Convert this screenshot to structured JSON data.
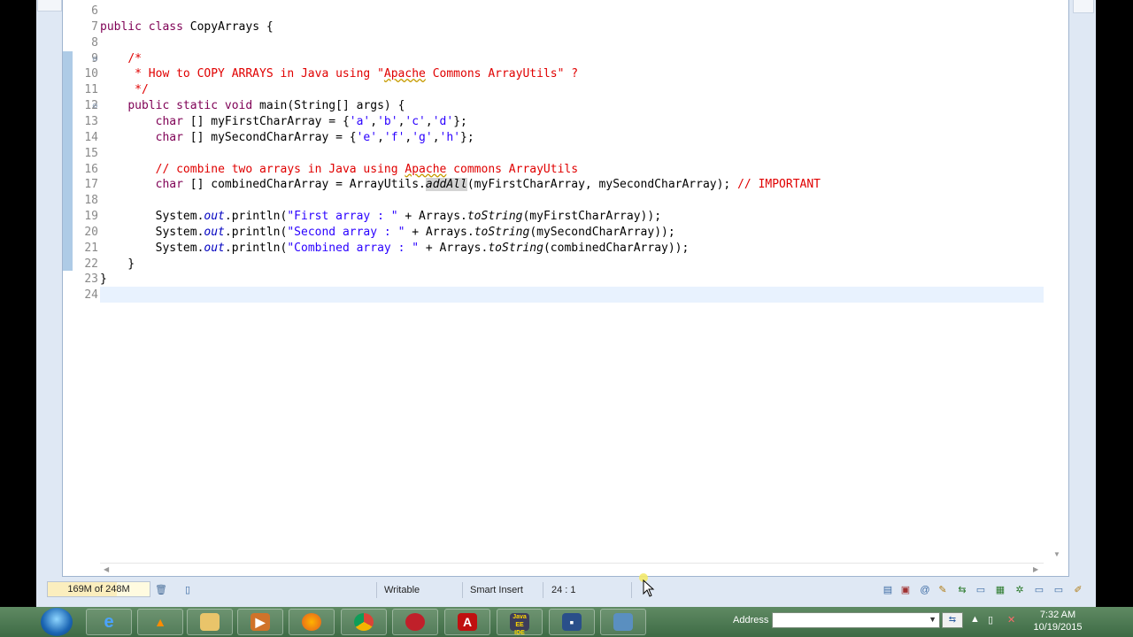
{
  "editor": {
    "lines": [
      {
        "no": "6",
        "html": ""
      },
      {
        "no": "7",
        "html": "<span class=\"kw\">public</span> <span class=\"kw\">class</span> CopyArrays {"
      },
      {
        "no": "8",
        "html": ""
      },
      {
        "no": "9",
        "html": "    <span class=\"cmt\">/*</span>"
      },
      {
        "no": "10",
        "html": "<span class=\"cmt\">     * How to COPY ARRAYS in Java using \"<span class=\"squig\">Apache</span> Commons ArrayUtils\" ?</span>"
      },
      {
        "no": "11",
        "html": "<span class=\"cmt\">     */</span>"
      },
      {
        "no": "12",
        "html": "    <span class=\"kw\">public</span> <span class=\"kw\">static</span> <span class=\"kw\">void</span> main(String[] args) {"
      },
      {
        "no": "13",
        "html": "        <span class=\"kw\">char</span> [] myFirstCharArray = {<span class=\"str\">'a'</span>,<span class=\"str\">'b'</span>,<span class=\"str\">'c'</span>,<span class=\"str\">'d'</span>};"
      },
      {
        "no": "14",
        "html": "        <span class=\"kw\">char</span> [] mySecondCharArray = {<span class=\"str\">'e'</span>,<span class=\"str\">'f'</span>,<span class=\"str\">'g'</span>,<span class=\"str\">'h'</span>};"
      },
      {
        "no": "15",
        "html": ""
      },
      {
        "no": "16",
        "html": "        <span class=\"cmt\">// combine two arrays in Java using <span class=\"squig\">Apache</span> commons ArrayUtils</span>"
      },
      {
        "no": "17",
        "html": "        <span class=\"kw\">char</span> [] combinedCharArray = ArrayUtils.<span class=\"ital hl\">addAll</span>(myFirstCharArray, mySecondCharArray); <span class=\"cmt\">// IMPORTANT</span>"
      },
      {
        "no": "18",
        "html": ""
      },
      {
        "no": "19",
        "html": "        System.<span class=\"fld\">out</span>.println(<span class=\"str\">\"First array : \"</span> + Arrays.<span class=\"ital\">toString</span>(myFirstCharArray));"
      },
      {
        "no": "20",
        "html": "        System.<span class=\"fld\">out</span>.println(<span class=\"str\">\"Second array : \"</span> + Arrays.<span class=\"ital\">toString</span>(mySecondCharArray));"
      },
      {
        "no": "21",
        "html": "        System.<span class=\"fld\">out</span>.println(<span class=\"str\">\"Combined array : \"</span> + Arrays.<span class=\"ital\">toString</span>(combinedCharArray));"
      },
      {
        "no": "22",
        "html": "    }"
      },
      {
        "no": "23",
        "html": "}"
      },
      {
        "no": "24",
        "html": ""
      }
    ],
    "folded_lines": [
      "9",
      "12"
    ]
  },
  "statusbar": {
    "heap": "169M of 248M",
    "heap_fraction": 0.68,
    "writable": "Writable",
    "insert_mode": "Smart Insert",
    "position": "24 : 1"
  },
  "taskbar": {
    "address_label": "Address",
    "time": "7:32 AM",
    "date": "10/19/2015",
    "buttons": [
      "ie-icon",
      "vlc-icon",
      "folder-icon",
      "media-icon",
      "firefox-icon",
      "chrome-icon",
      "redapp-icon",
      "acrobat-icon",
      "javaee-ide-icon",
      "save-app-icon",
      "picture-icon"
    ],
    "javaee_label": "Java EE IDE"
  },
  "colors": {
    "keyword": "#7f0055",
    "comment": "#e00000",
    "string": "#2a00ff",
    "field": "#0000c0"
  }
}
